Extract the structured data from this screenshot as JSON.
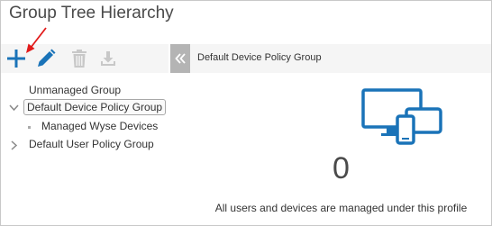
{
  "page": {
    "title": "Group Tree Hierarchy"
  },
  "toolbar": {
    "add": {
      "icon": "plus-icon",
      "color": "#1a73b8"
    },
    "edit": {
      "icon": "pencil-icon",
      "color": "#1a73b8"
    },
    "delete": {
      "icon": "trash-icon",
      "color": "#c8c8c8"
    },
    "import": {
      "icon": "download-icon",
      "color": "#c8c8c8"
    }
  },
  "tree": {
    "items": [
      {
        "label": "Unmanaged Group"
      },
      {
        "label": "Default Device Policy Group",
        "selected": true,
        "expanded": true
      },
      {
        "label": "Managed Wyse Devices"
      },
      {
        "label": "Default User Policy Group",
        "expanded": false
      }
    ]
  },
  "panel": {
    "title": "Default Device Policy Group",
    "device_count": "0",
    "message": "All users and devices are managed under this profile"
  },
  "colors": {
    "accent": "#1a73b8",
    "annotation_arrow": "#e21b1b"
  }
}
